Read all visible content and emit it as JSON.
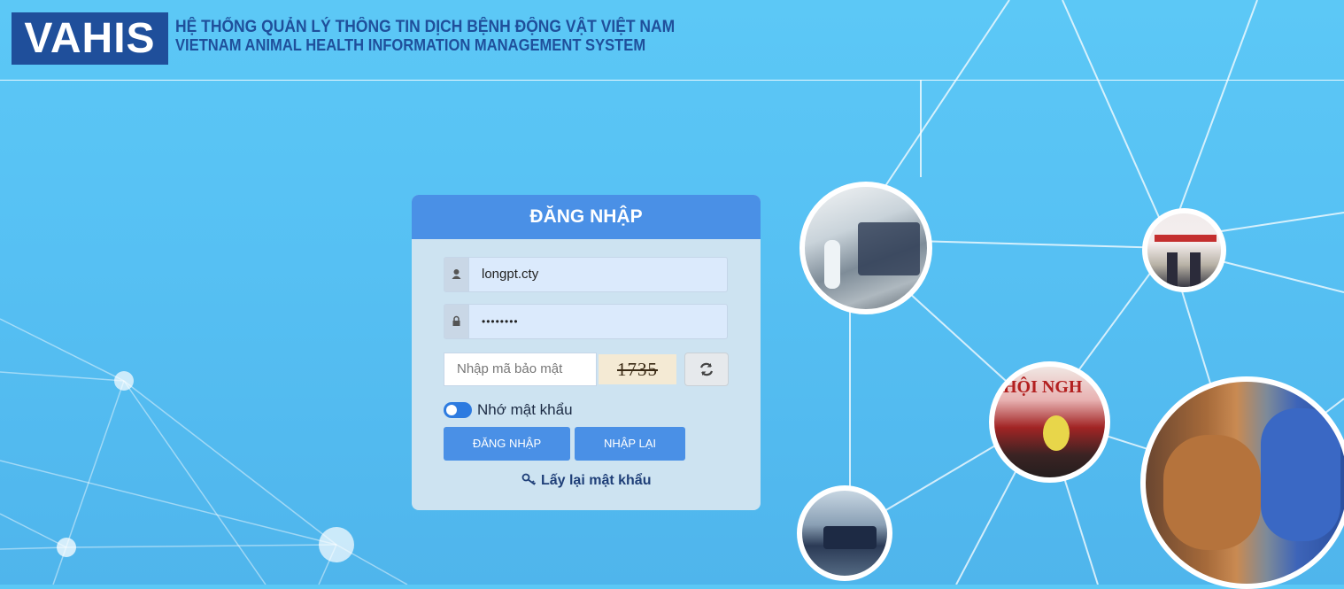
{
  "header": {
    "logo_text": "VAHIS",
    "title_vi": "HỆ THỐNG QUẢN LÝ THÔNG TIN DỊCH BỆNH ĐỘNG VẬT VIỆT NAM",
    "title_en": "VIETNAM ANIMAL HEALTH INFORMATION MANAGEMENT SYSTEM"
  },
  "login": {
    "heading": "ĐĂNG NHẬP",
    "username_value": "longpt.cty",
    "password_value": "••••••••",
    "captcha_placeholder": "Nhập mã bảo mật",
    "captcha_code": "1735",
    "remember_label": "Nhớ mật khẩu",
    "remember_checked": true,
    "login_button": "ĐĂNG NHẬP",
    "reset_button": "NHẬP LẠI",
    "forgot_link": "Lấy lại mật khẩu"
  },
  "icons": {
    "username": "user-icon",
    "password": "lock-icon",
    "refresh": "refresh-icon",
    "forgot": "key-icon"
  },
  "colors": {
    "brand": "#1f4f9b",
    "accent": "#4a90e6",
    "background": "#56c0f3"
  }
}
